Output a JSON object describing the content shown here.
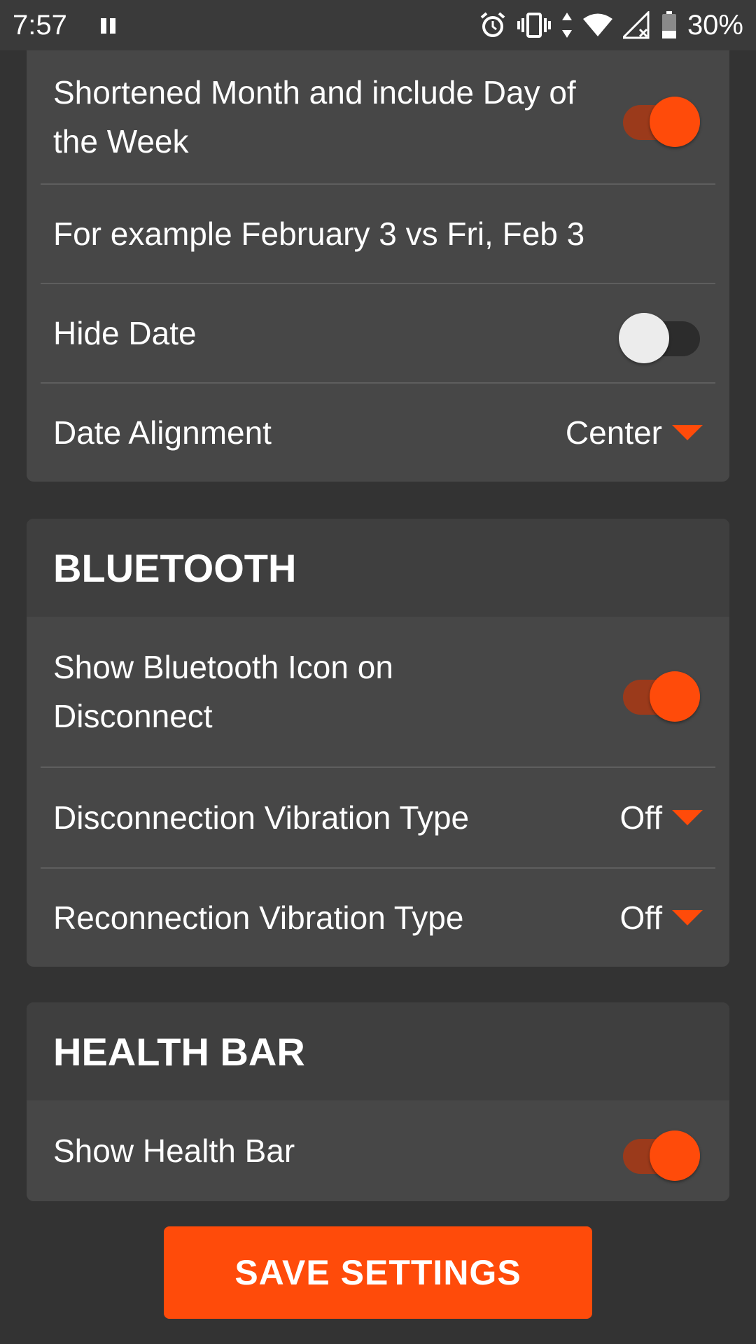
{
  "status_bar": {
    "time": "7:57",
    "battery": "30%",
    "icons": [
      "pause-icon",
      "alarm-icon",
      "vibrate-icon",
      "data-arrows-icon",
      "wifi-icon",
      "signal-icon",
      "battery-icon"
    ]
  },
  "date_card": {
    "rows": [
      {
        "label": "Shortened Month and include Day of the Week",
        "toggle": "on"
      },
      {
        "label": "For example February 3 vs Fri, Feb 3"
      },
      {
        "label": "Hide Date",
        "toggle": "off"
      },
      {
        "label": "Date Alignment",
        "value": "Center"
      }
    ]
  },
  "bluetooth_card": {
    "title": "BLUETOOTH",
    "rows": [
      {
        "label": "Show Bluetooth Icon on Disconnect",
        "toggle": "on"
      },
      {
        "label": "Disconnection Vibration Type",
        "value": "Off"
      },
      {
        "label": "Reconnection Vibration Type",
        "value": "Off"
      }
    ]
  },
  "health_card": {
    "title": "HEALTH BAR",
    "rows": [
      {
        "label": "Show Health Bar",
        "toggle": "on"
      }
    ]
  },
  "save_button": {
    "label": "SAVE SETTINGS"
  },
  "colors": {
    "accent": "#ff4b0a",
    "background": "#333333",
    "card": "#474747",
    "card_header": "#3f3f3f"
  }
}
